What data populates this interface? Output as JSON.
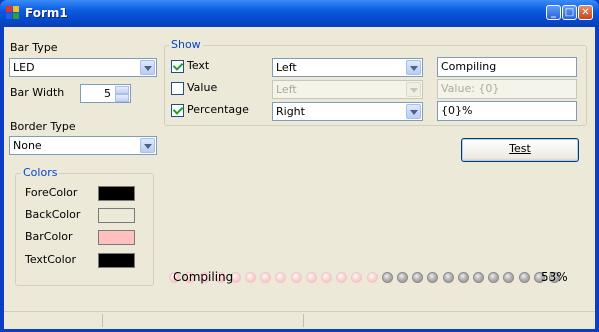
{
  "window": {
    "title": "Form1"
  },
  "left_panel": {
    "bar_type_label": "Bar Type",
    "bar_type_value": "LED",
    "bar_width_label": "Bar Width",
    "bar_width_value": "5",
    "border_type_label": "Border Type",
    "border_type_value": "None"
  },
  "colors": {
    "group_title": "Colors",
    "items": [
      {
        "label": "ForeColor",
        "color": "#000000"
      },
      {
        "label": "BackColor",
        "color": "#ece9d8"
      },
      {
        "label": "BarColor",
        "color": "#ffc0c0"
      },
      {
        "label": "TextColor",
        "color": "#000000"
      }
    ]
  },
  "show": {
    "group_title": "Show",
    "rows": [
      {
        "label": "Text",
        "checked": true,
        "align": "Left",
        "format": "Compiling",
        "enabled": true
      },
      {
        "label": "Value",
        "checked": false,
        "align": "Left",
        "format": "Value: {0}",
        "enabled": false
      },
      {
        "label": "Percentage",
        "checked": true,
        "align": "Right",
        "format": "{0}%",
        "enabled": true
      }
    ]
  },
  "test_button": {
    "label": "Test"
  },
  "progress": {
    "text": "Compiling",
    "percent_text": "53%",
    "fraction": 0.53,
    "on_color": "#ffc0c0"
  }
}
